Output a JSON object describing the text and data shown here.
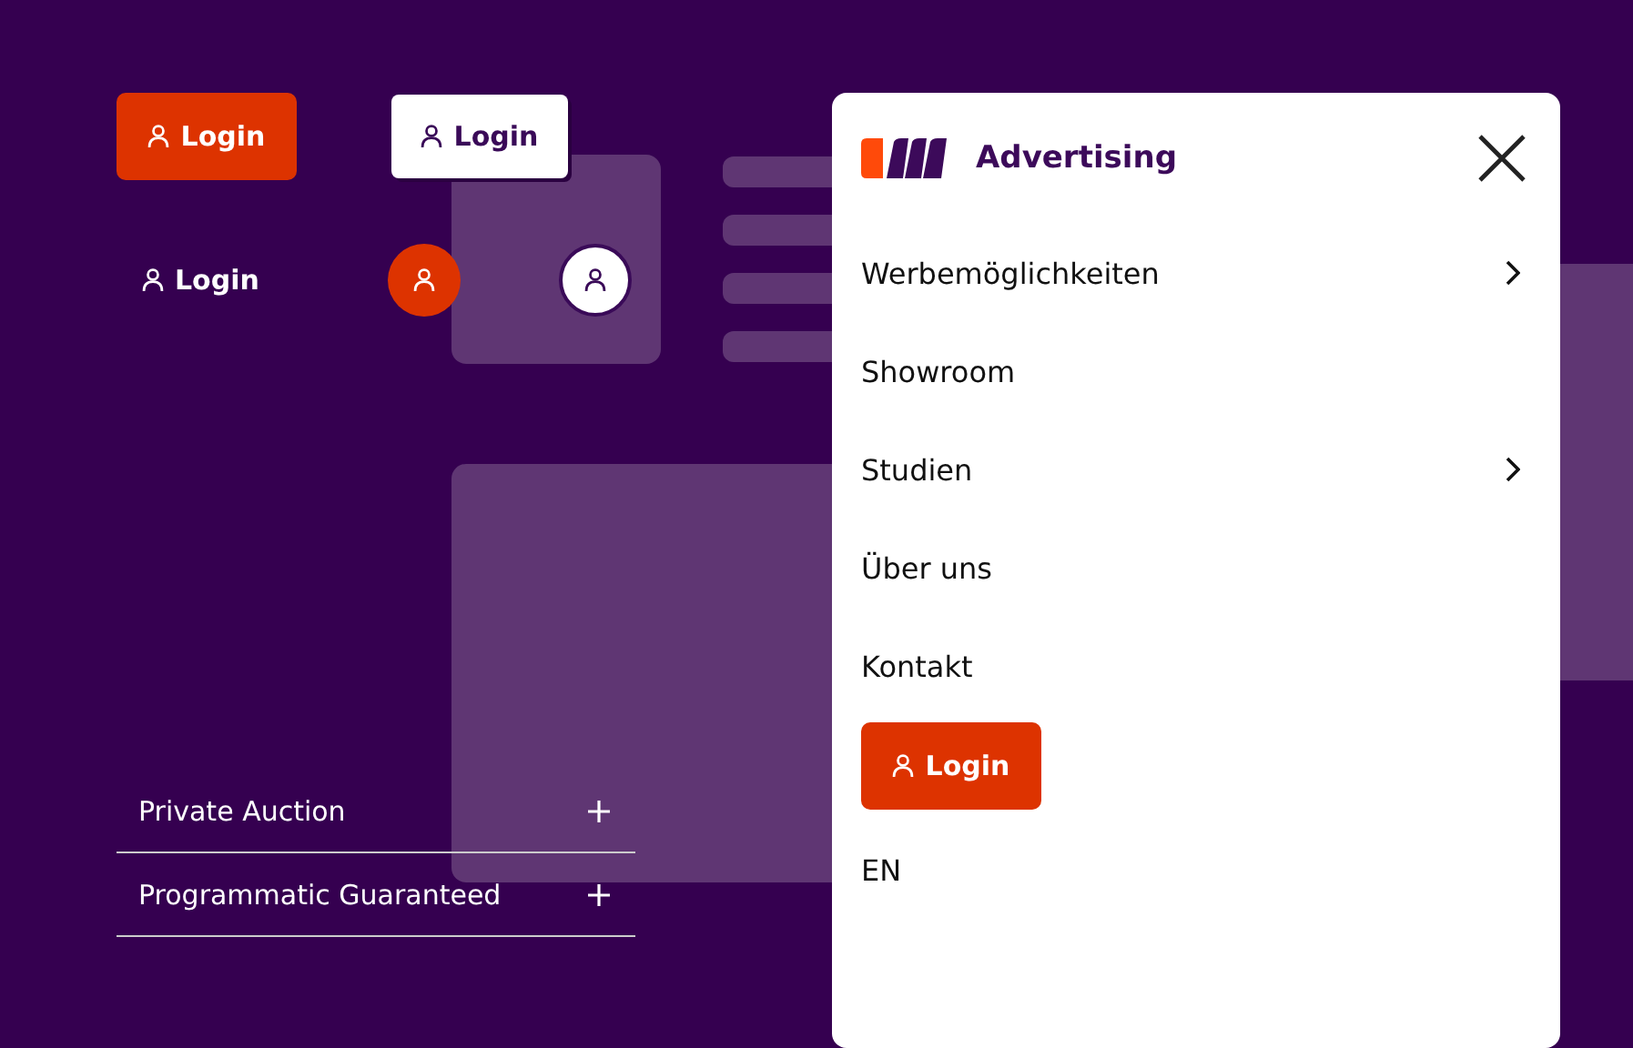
{
  "login_variants": [
    {
      "kind": "filled",
      "label": "Login"
    },
    {
      "kind": "outline",
      "label": "Login"
    },
    {
      "kind": "text",
      "label": "Login"
    },
    {
      "kind": "icon-filled"
    },
    {
      "kind": "icon-outline"
    }
  ],
  "accordion": [
    {
      "label": "Private Auction",
      "expanded": false
    },
    {
      "label": "Programmatic Guaranteed",
      "expanded": false
    }
  ],
  "menu": {
    "brand": "Advertising",
    "items": [
      {
        "label": "Werbemöglichkeiten",
        "has_submenu": true
      },
      {
        "label": "Showroom",
        "has_submenu": false
      },
      {
        "label": "Studien",
        "has_submenu": true
      },
      {
        "label": "Über uns",
        "has_submenu": false
      },
      {
        "label": "Kontakt",
        "has_submenu": false
      }
    ],
    "login": "Login",
    "language": "EN"
  }
}
